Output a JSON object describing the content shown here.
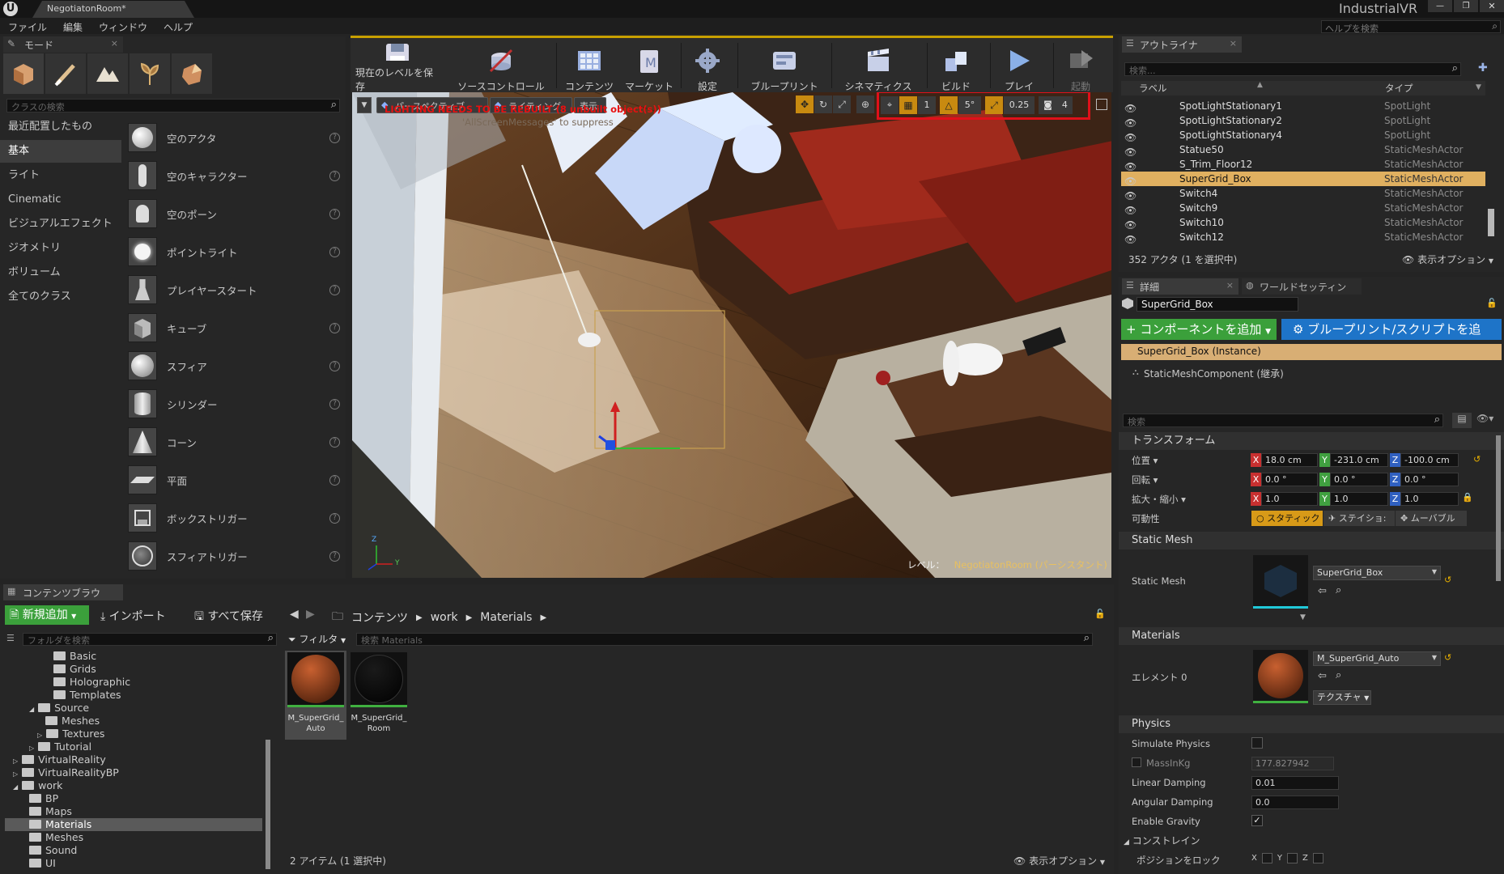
{
  "title_bar": {
    "tab": "NegotiatonRoom*",
    "project": "IndustrialVR",
    "help_search": "ヘルプを検索"
  },
  "menu": [
    "ファイル",
    "編集",
    "ウィンドウ",
    "ヘルプ"
  ],
  "modes": {
    "tab": "モード",
    "search_placeholder": "クラスの検索",
    "categories": [
      "最近配置したもの",
      "基本",
      "ライト",
      "Cinematic",
      "ビジュアルエフェクト",
      "ジオメトリ",
      "ボリューム",
      "全てのクラス"
    ],
    "items": [
      "空のアクタ",
      "空のキャラクター",
      "空のポーン",
      "ポイントライト",
      "プレイヤースタート",
      "キューブ",
      "スフィア",
      "シリンダー",
      "コーン",
      "平面",
      "ボックストリガー",
      "スフィアトリガー"
    ]
  },
  "toolbar": [
    "現在のレベルを保存",
    "ソースコントロール",
    "コンテンツ",
    "マーケット",
    "設定",
    "ブループリント",
    "シネマティクス",
    "ビルド",
    "プレイ",
    "起動"
  ],
  "viewport": {
    "perspective": "パースペクティブ",
    "lighting": "ライティング",
    "show": "表示",
    "warning": "LIGHTING NEEDS TO BE REBUILT (8 unbuilt object(s))",
    "warning2": "'AllScreenMessages' to suppress",
    "snap_grid": "1",
    "snap_rot": "5°",
    "snap_scale": "0.25",
    "cam_speed": "4",
    "level_label": "レベル：",
    "level_name": "NegotiatonRoom (パーシスタント)",
    "axis_z": "Z",
    "axis_y": "Y"
  },
  "outliner": {
    "tab": "アウトライナ",
    "search_placeholder": "検索...",
    "col_label": "ラベル",
    "col_type": "タイプ",
    "rows": [
      {
        "label": "SpotLightStationary1",
        "type": "SpotLight"
      },
      {
        "label": "SpotLightStationary2",
        "type": "SpotLight"
      },
      {
        "label": "SpotLightStationary4",
        "type": "SpotLight"
      },
      {
        "label": "Statue50",
        "type": "StaticMeshActor"
      },
      {
        "label": "S_Trim_Floor12",
        "type": "StaticMeshActor"
      },
      {
        "label": "SuperGrid_Box",
        "type": "StaticMeshActor"
      },
      {
        "label": "Switch4",
        "type": "StaticMeshActor"
      },
      {
        "label": "Switch9",
        "type": "StaticMeshActor"
      },
      {
        "label": "Switch10",
        "type": "StaticMeshActor"
      },
      {
        "label": "Switch12",
        "type": "StaticMeshActor"
      }
    ],
    "count": "352 アクタ (1 を選択中)",
    "view_options": "表示オプション"
  },
  "details": {
    "tab": "詳細",
    "tab2": "ワールドセッティン",
    "name": "SuperGrid_Box",
    "add_component": "コンポーネントを追加",
    "blueprint_script": "ブループリント/スクリプトを追",
    "instance": "SuperGrid_Box (Instance)",
    "component": "StaticMeshComponent (継承)",
    "search_placeholder": "検索",
    "transform": "トランスフォーム",
    "location_label": "位置",
    "rotation_label": "回転",
    "scale_label": "拡大・縮小",
    "mobility_label": "可動性",
    "location": [
      "18.0 cm",
      "-231.0 cm",
      "-100.0 cm"
    ],
    "rotation": [
      "0.0 °",
      "0.0 °",
      "0.0 °"
    ],
    "scale": [
      "1.0",
      "1.0",
      "1.0"
    ],
    "mobility": [
      "スタティック",
      "ステイショ:",
      "ムーバブル"
    ],
    "static_mesh_section": "Static Mesh",
    "static_mesh_label": "Static Mesh",
    "static_mesh_value": "SuperGrid_Box",
    "materials_section": "Materials",
    "element_label": "エレメント 0",
    "material_value": "M_SuperGrid_Auto",
    "texture_btn": "テクスチャ",
    "physics_section": "Physics",
    "simulate_physics": "Simulate Physics",
    "mass": "MassInKg",
    "mass_value": "177.827942",
    "linear_damping": "Linear Damping",
    "linear_damping_value": "0.01",
    "angular_damping": "Angular Damping",
    "angular_damping_value": "0.0",
    "enable_gravity": "Enable Gravity",
    "constraint": "コンストレイン",
    "lock_position": "ポジションをロック"
  },
  "content_browser": {
    "tab": "コンテンツブラウ",
    "add_new": "新規追加",
    "import": "インポート",
    "save_all": "すべて保存",
    "path": [
      "コンテンツ",
      "work",
      "Materials"
    ],
    "folder_search": "フォルダを検索",
    "filter": "フィルタ",
    "asset_search": "検索 Materials",
    "folders": [
      "Basic",
      "Grids",
      "Holographic",
      "Templates",
      "Source",
      "Meshes",
      "Textures",
      "Tutorial",
      "VirtualReality",
      "VirtualRealityBP",
      "work",
      "BP",
      "Maps",
      "Materials",
      "Meshes",
      "Sound",
      "UI"
    ],
    "assets": [
      {
        "line1": "M_SuperGrid_",
        "line2": "Auto"
      },
      {
        "line1": "M_SuperGrid_",
        "line2": "Room"
      }
    ],
    "status": "2 アイテム (1 選択中)",
    "view_options": "表示オプション"
  }
}
